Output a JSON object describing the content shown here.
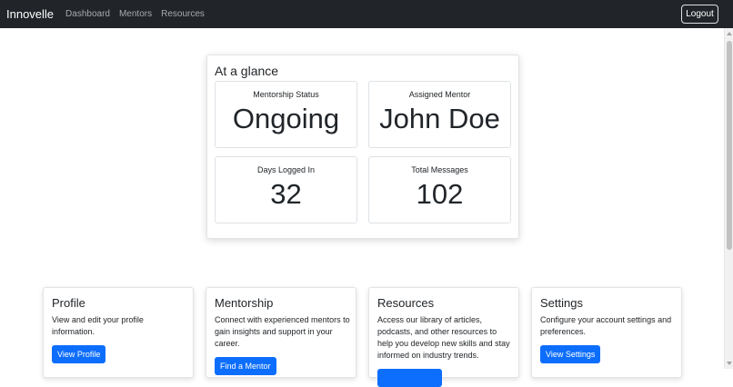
{
  "navbar": {
    "brand": "Innovelle",
    "links": [
      "Dashboard",
      "Mentors",
      "Resources"
    ],
    "logout_label": "Logout"
  },
  "glance": {
    "title": "At a glance",
    "stats": [
      {
        "label": "Mentorship Status",
        "value": "Ongoing"
      },
      {
        "label": "Assigned Mentor",
        "value": "John Doe"
      },
      {
        "label": "Days Logged In",
        "value": "32"
      },
      {
        "label": "Total Messages",
        "value": "102"
      }
    ]
  },
  "cards": [
    {
      "title": "Profile",
      "text": "View and edit your profile information.",
      "button": "View Profile"
    },
    {
      "title": "Mentorship",
      "text": "Connect with experienced mentors to gain insights and support in your career.",
      "button": "Find a Mentor"
    },
    {
      "title": "Resources",
      "text": "Access our library of articles, podcasts, and other resources to help you develop new skills and stay informed on industry trends.",
      "button": ""
    },
    {
      "title": "Settings",
      "text": "Configure your account settings and preferences.",
      "button": "View Settings"
    }
  ],
  "colors": {
    "navbar_bg": "#212529",
    "primary": "#0d6efd"
  }
}
